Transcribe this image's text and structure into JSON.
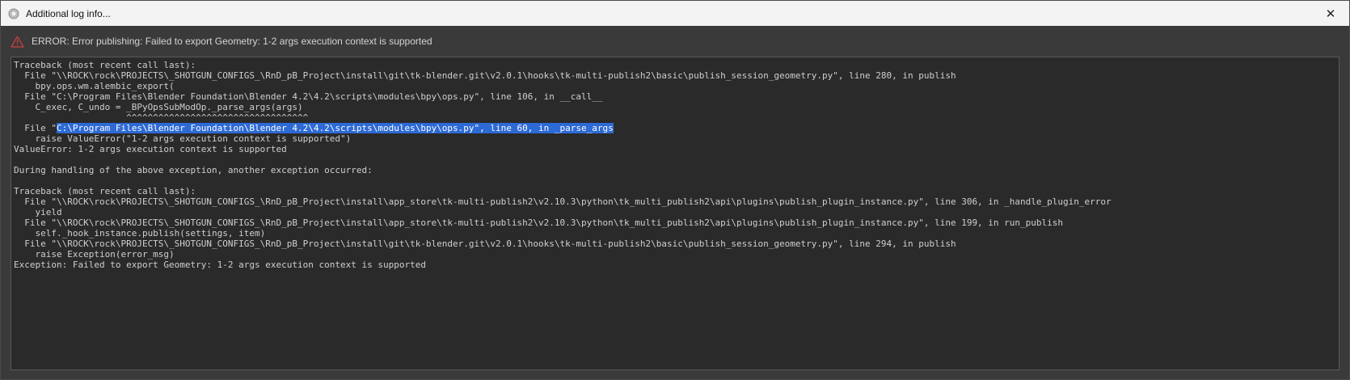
{
  "window": {
    "title": "Additional log info...",
    "close_glyph": "✕"
  },
  "error": {
    "message": "ERROR: Error publishing: Failed to export Geometry: 1-2 args execution context is supported",
    "icon": "warning-triangle-icon",
    "icon_color": "#c94040"
  },
  "log": {
    "lines": [
      "Traceback (most recent call last):",
      "  File \"\\\\ROCK\\rock\\PROJECTS\\_SHOTGUN_CONFIGS_\\RnD_pB_Project\\install\\git\\tk-blender.git\\v2.0.1\\hooks\\tk-multi-publish2\\basic\\publish_session_geometry.py\", line 280, in publish",
      "    bpy.ops.wm.alembic_export(",
      "  File \"C:\\Program Files\\Blender Foundation\\Blender 4.2\\4.2\\scripts\\modules\\bpy\\ops.py\", line 106, in __call__",
      "    C_exec, C_undo = _BPyOpsSubModOp._parse_args(args)",
      "                     ^^^^^^^^^^^^^^^^^^^^^^^^^^^^^^^^^^",
      "",
      "    raise ValueError(\"1-2 args execution context is supported\")",
      "ValueError: 1-2 args execution context is supported",
      "",
      "During handling of the above exception, another exception occurred:",
      "",
      "Traceback (most recent call last):",
      "  File \"\\\\ROCK\\rock\\PROJECTS\\_SHOTGUN_CONFIGS_\\RnD_pB_Project\\install\\app_store\\tk-multi-publish2\\v2.10.3\\python\\tk_multi_publish2\\api\\plugins\\publish_plugin_instance.py\", line 306, in _handle_plugin_error",
      "    yield",
      "  File \"\\\\ROCK\\rock\\PROJECTS\\_SHOTGUN_CONFIGS_\\RnD_pB_Project\\install\\app_store\\tk-multi-publish2\\v2.10.3\\python\\tk_multi_publish2\\api\\plugins\\publish_plugin_instance.py\", line 199, in run_publish",
      "    self._hook_instance.publish(settings, item)",
      "  File \"\\\\ROCK\\rock\\PROJECTS\\_SHOTGUN_CONFIGS_\\RnD_pB_Project\\install\\git\\tk-blender.git\\v2.0.1\\hooks\\tk-multi-publish2\\basic\\publish_session_geometry.py\", line 294, in publish",
      "    raise Exception(error_msg)",
      "Exception: Failed to export Geometry: 1-2 args execution context is supported"
    ],
    "selected_line": {
      "prefix": "  File \"",
      "selected": "C:\\Program Files\\Blender Foundation\\Blender 4.2\\4.2\\scripts\\modules\\bpy\\ops.py\", line 60, in _parse_args"
    }
  }
}
